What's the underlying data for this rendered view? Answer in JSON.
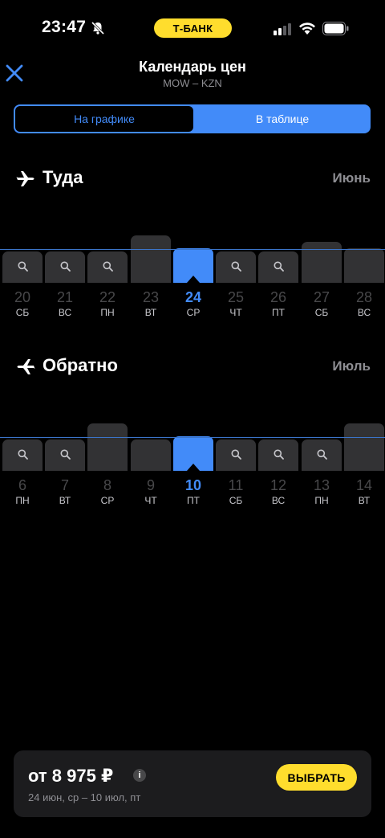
{
  "status_bar": {
    "time": "23:47",
    "bank": "Т-БАНК"
  },
  "header": {
    "title": "Календарь цен",
    "route": "MOW – KZN"
  },
  "tabs": [
    {
      "label": "На графике",
      "active": true
    },
    {
      "label": "В таблице",
      "active": false
    }
  ],
  "outbound": {
    "title": "Туда",
    "month": "Июнь",
    "days": [
      {
        "num": "20",
        "name": "СБ",
        "level": "low",
        "search": true
      },
      {
        "num": "21",
        "name": "ВС",
        "level": "low",
        "search": true
      },
      {
        "num": "22",
        "name": "ПН",
        "level": "low",
        "search": true
      },
      {
        "num": "23",
        "name": "ВТ",
        "level": "high",
        "search": false
      },
      {
        "num": "24",
        "name": "СР",
        "level": "mid",
        "search": false,
        "selected": true
      },
      {
        "num": "25",
        "name": "ЧТ",
        "level": "low",
        "search": true
      },
      {
        "num": "26",
        "name": "ПТ",
        "level": "low",
        "search": true
      },
      {
        "num": "27",
        "name": "СБ",
        "level": "high2",
        "search": false
      },
      {
        "num": "28",
        "name": "ВС",
        "level": "mid",
        "search": false
      }
    ]
  },
  "return": {
    "title": "Обратно",
    "month": "Июль",
    "days": [
      {
        "num": "6",
        "name": "ПН",
        "level": "low",
        "search": true
      },
      {
        "num": "7",
        "name": "ВТ",
        "level": "low",
        "search": true
      },
      {
        "num": "8",
        "name": "СР",
        "level": "high",
        "search": false
      },
      {
        "num": "9",
        "name": "ЧТ",
        "level": "low",
        "search": false
      },
      {
        "num": "10",
        "name": "ПТ",
        "level": "mid",
        "search": false,
        "selected": true
      },
      {
        "num": "11",
        "name": "СБ",
        "level": "low",
        "search": true
      },
      {
        "num": "12",
        "name": "ВС",
        "level": "low",
        "search": true
      },
      {
        "num": "13",
        "name": "ПН",
        "level": "low",
        "search": true
      },
      {
        "num": "14",
        "name": "ВТ",
        "level": "high",
        "search": false
      }
    ]
  },
  "summary": {
    "price": "от 8 975 ₽",
    "info": "i",
    "dates": "24 июн, ср – 10 июл, пт",
    "button": "ВЫБРАТЬ"
  },
  "colors": {
    "accent": "#428bf9",
    "yellow": "#ffdd2d",
    "bar": "#323234"
  }
}
